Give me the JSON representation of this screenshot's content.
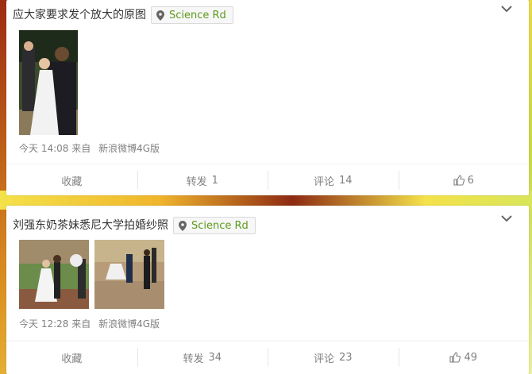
{
  "posts": [
    {
      "text": "应大家要求发个放大的原图",
      "location": "Science Rd",
      "time": "今天 14:08",
      "source_prefix": "来自",
      "source": "新浪微博4G版",
      "images": [
        "photo-bride-groom-closeup"
      ],
      "actions": {
        "favorite_label": "收藏",
        "repost_label": "转发",
        "repost_count": "1",
        "comment_label": "评论",
        "comment_count": "14",
        "like_count": "6"
      }
    },
    {
      "text": "刘强东奶茶妹悉尼大学拍婚纱照",
      "location": "Science Rd",
      "time": "今天 12:28",
      "source_prefix": "来自",
      "source": "新浪微博4G版",
      "images": [
        "photo-wedding-lawn",
        "photo-wedding-courtyard"
      ],
      "actions": {
        "favorite_label": "收藏",
        "repost_label": "转发",
        "repost_count": "34",
        "comment_label": "评论",
        "comment_count": "23",
        "like_count": "49"
      }
    }
  ],
  "icons": {
    "location": "map-pin-icon",
    "expand": "chevron-down-icon",
    "like": "thumbs-up-icon"
  },
  "colors": {
    "location_text": "#5c9a1b",
    "meta_text": "#808080",
    "post_text": "#333333"
  }
}
